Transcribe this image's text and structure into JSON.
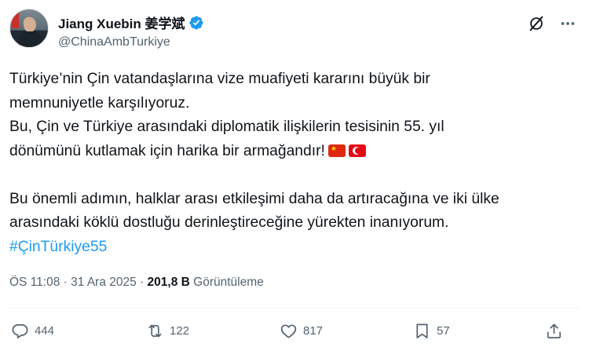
{
  "author": {
    "display_name": "Jiang Xuebin 姜学斌",
    "handle": "@ChinaAmbTurkiye",
    "verified": true
  },
  "tweet": {
    "lines": [
      "Türkiye’nin Çin vatandaşlarına vize muafiyeti kararını büyük bir",
      "memnuniyetle karşılıyoruz.",
      "Bu, Çin ve Türkiye arasındaki diplomatik ilişkilerin tesisinin 55. yıl",
      "dönümünü kutlamak için harika bir armağandır!",
      "Bu önemli adımın, halklar arası etkileşimi daha da artıracağına ve iki ülke",
      "arasındaki köklü dostluğu derinleştireceğine yürekten inanıyorum."
    ],
    "hashtag": "#ÇinTürkiye55",
    "emoji": [
      "china-flag",
      "turkey-flag"
    ]
  },
  "meta": {
    "time": "ÖS 11:08",
    "separator": "·",
    "date": "31 Ara 2025",
    "views_count": "201,8 B",
    "views_label": "Görüntüleme"
  },
  "actions": {
    "replies": "444",
    "reposts": "122",
    "likes": "817",
    "bookmarks": "57"
  },
  "colors": {
    "text": "#0f1419",
    "secondary": "#536471",
    "link": "#1d9bf0",
    "verified": "#1d9bf0"
  }
}
